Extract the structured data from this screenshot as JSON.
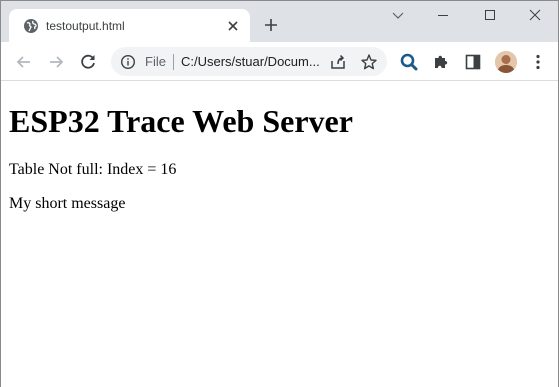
{
  "tab": {
    "title": "testoutput.html"
  },
  "address_bar": {
    "scheme_label": "File",
    "url": "C:/Users/stuar/Documents/testoutput.html"
  },
  "page": {
    "heading": "ESP32 Trace Web Server",
    "paragraphs": [
      "Table Not full: Index = 16",
      "My short message"
    ]
  },
  "icons": {
    "favicon": "globe-icon",
    "tab_close": "close-icon",
    "new_tab": "plus-icon",
    "tab_search": "chevron-down-icon",
    "minimize": "minimize-icon",
    "maximize": "maximize-icon",
    "close_window": "close-icon",
    "back": "arrow-left-icon",
    "forward": "arrow-right-icon",
    "reload": "reload-icon",
    "site_info": "info-icon",
    "share": "share-icon",
    "bookmark": "star-icon",
    "search_extension": "search-icon",
    "extensions": "puzzle-icon",
    "side_panel": "side-panel-icon",
    "profile": "avatar",
    "menu": "kebab-menu-icon"
  },
  "colors": {
    "tabstrip_bg": "#dee1e6",
    "omnibox_bg": "#f1f3f4",
    "search_extension_blue": "#1a5a8a"
  }
}
